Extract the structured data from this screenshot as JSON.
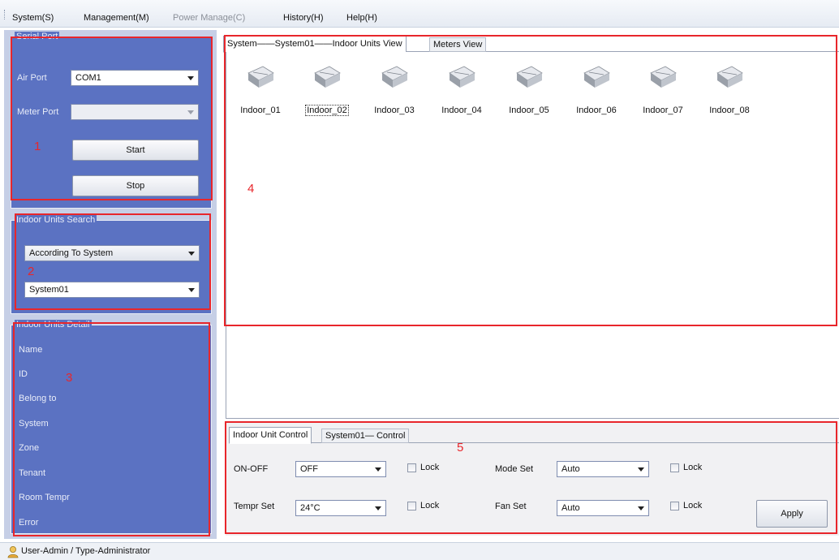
{
  "menu": [
    {
      "label": "System(S)",
      "enabled": true
    },
    {
      "label": "Management(M)",
      "enabled": true
    },
    {
      "label": "Power Manage(C)",
      "enabled": false
    },
    {
      "label": "History(H)",
      "enabled": true
    },
    {
      "label": "Help(H)",
      "enabled": true
    }
  ],
  "serial_port": {
    "title": "Serial Port",
    "air_port_label": "Air Port",
    "air_port_value": "COM1",
    "meter_port_label": "Meter Port",
    "meter_port_value": "",
    "start_label": "Start",
    "stop_label": "Stop"
  },
  "search": {
    "title": "Indoor Units Search",
    "mode_value": "According To System",
    "system_value": "System01"
  },
  "detail": {
    "title": "Indoor Units Detail",
    "fields": [
      "Name",
      "ID",
      "Belong to",
      "System",
      "Zone",
      "Tenant",
      "Room Tempr",
      "Error"
    ]
  },
  "view_tabs": [
    {
      "label": "System——System01——Indoor Units View",
      "active": true
    },
    {
      "label": "Meters View",
      "active": false
    }
  ],
  "units": [
    "Indoor_01",
    "Indoor_02",
    "Indoor_03",
    "Indoor_04",
    "Indoor_05",
    "Indoor_06",
    "Indoor_07",
    "Indoor_08"
  ],
  "focused_unit": "Indoor_02",
  "control_tabs": [
    {
      "label": "Indoor Unit Control",
      "active": true
    },
    {
      "label": "System01— Control",
      "active": false
    }
  ],
  "controls": {
    "on_off_label": "ON-OFF",
    "on_off_value": "OFF",
    "mode_label": "Mode Set",
    "mode_value": "Auto",
    "tempr_label": "Tempr Set",
    "tempr_value": "24°C",
    "fan_label": "Fan Set",
    "fan_value": "Auto",
    "lock_label": "Lock",
    "apply_label": "Apply"
  },
  "annotations": [
    "1",
    "2",
    "3",
    "4",
    "5"
  ],
  "status": {
    "text": "User-Admin / Type-Administrator"
  },
  "colors": {
    "panel_blue": "#5b72c2",
    "annotation_red": "#e8262b"
  }
}
